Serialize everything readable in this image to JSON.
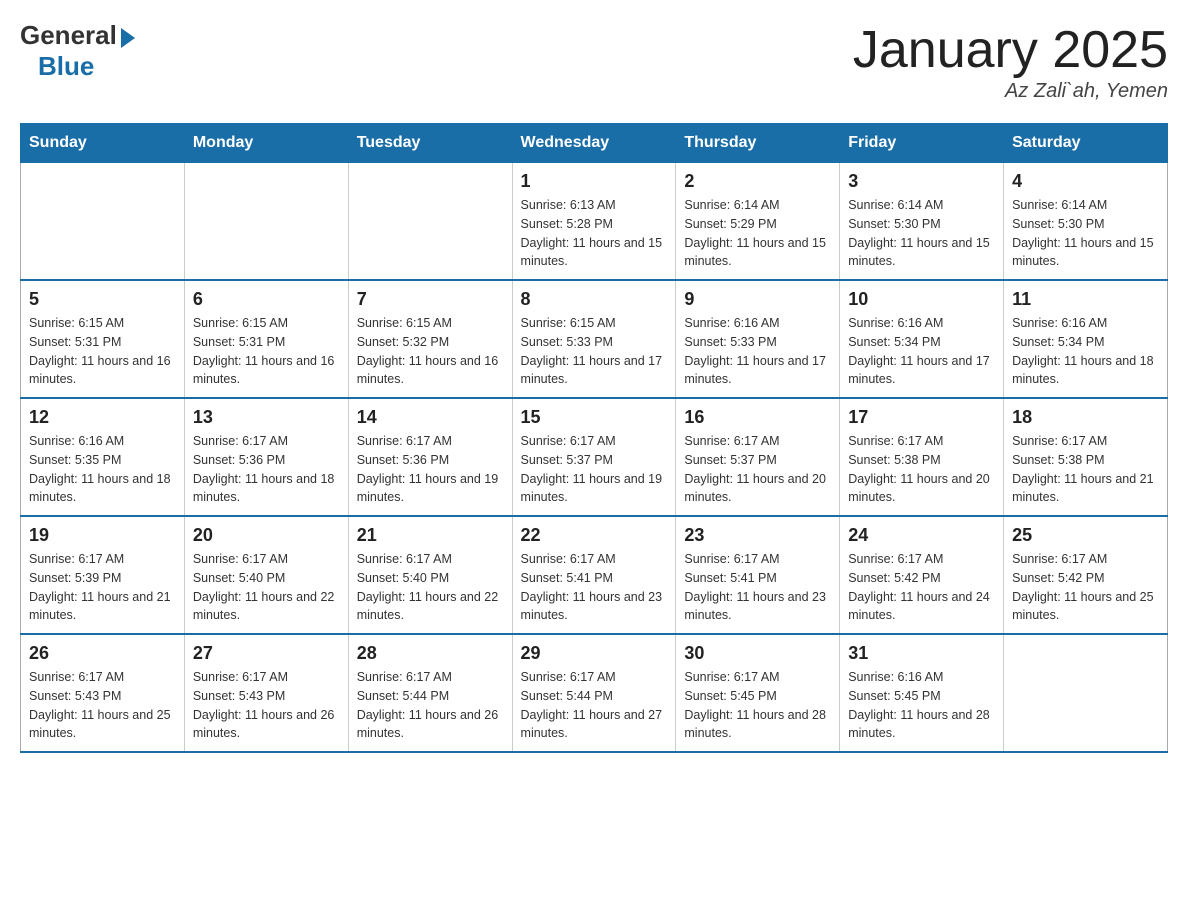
{
  "header": {
    "logo_general": "General",
    "logo_blue": "Blue",
    "month_title": "January 2025",
    "location": "Az Zali`ah, Yemen"
  },
  "calendar": {
    "days_of_week": [
      "Sunday",
      "Monday",
      "Tuesday",
      "Wednesday",
      "Thursday",
      "Friday",
      "Saturday"
    ],
    "weeks": [
      [
        {
          "day": "",
          "info": ""
        },
        {
          "day": "",
          "info": ""
        },
        {
          "day": "",
          "info": ""
        },
        {
          "day": "1",
          "info": "Sunrise: 6:13 AM\nSunset: 5:28 PM\nDaylight: 11 hours and 15 minutes."
        },
        {
          "day": "2",
          "info": "Sunrise: 6:14 AM\nSunset: 5:29 PM\nDaylight: 11 hours and 15 minutes."
        },
        {
          "day": "3",
          "info": "Sunrise: 6:14 AM\nSunset: 5:30 PM\nDaylight: 11 hours and 15 minutes."
        },
        {
          "day": "4",
          "info": "Sunrise: 6:14 AM\nSunset: 5:30 PM\nDaylight: 11 hours and 15 minutes."
        }
      ],
      [
        {
          "day": "5",
          "info": "Sunrise: 6:15 AM\nSunset: 5:31 PM\nDaylight: 11 hours and 16 minutes."
        },
        {
          "day": "6",
          "info": "Sunrise: 6:15 AM\nSunset: 5:31 PM\nDaylight: 11 hours and 16 minutes."
        },
        {
          "day": "7",
          "info": "Sunrise: 6:15 AM\nSunset: 5:32 PM\nDaylight: 11 hours and 16 minutes."
        },
        {
          "day": "8",
          "info": "Sunrise: 6:15 AM\nSunset: 5:33 PM\nDaylight: 11 hours and 17 minutes."
        },
        {
          "day": "9",
          "info": "Sunrise: 6:16 AM\nSunset: 5:33 PM\nDaylight: 11 hours and 17 minutes."
        },
        {
          "day": "10",
          "info": "Sunrise: 6:16 AM\nSunset: 5:34 PM\nDaylight: 11 hours and 17 minutes."
        },
        {
          "day": "11",
          "info": "Sunrise: 6:16 AM\nSunset: 5:34 PM\nDaylight: 11 hours and 18 minutes."
        }
      ],
      [
        {
          "day": "12",
          "info": "Sunrise: 6:16 AM\nSunset: 5:35 PM\nDaylight: 11 hours and 18 minutes."
        },
        {
          "day": "13",
          "info": "Sunrise: 6:17 AM\nSunset: 5:36 PM\nDaylight: 11 hours and 18 minutes."
        },
        {
          "day": "14",
          "info": "Sunrise: 6:17 AM\nSunset: 5:36 PM\nDaylight: 11 hours and 19 minutes."
        },
        {
          "day": "15",
          "info": "Sunrise: 6:17 AM\nSunset: 5:37 PM\nDaylight: 11 hours and 19 minutes."
        },
        {
          "day": "16",
          "info": "Sunrise: 6:17 AM\nSunset: 5:37 PM\nDaylight: 11 hours and 20 minutes."
        },
        {
          "day": "17",
          "info": "Sunrise: 6:17 AM\nSunset: 5:38 PM\nDaylight: 11 hours and 20 minutes."
        },
        {
          "day": "18",
          "info": "Sunrise: 6:17 AM\nSunset: 5:38 PM\nDaylight: 11 hours and 21 minutes."
        }
      ],
      [
        {
          "day": "19",
          "info": "Sunrise: 6:17 AM\nSunset: 5:39 PM\nDaylight: 11 hours and 21 minutes."
        },
        {
          "day": "20",
          "info": "Sunrise: 6:17 AM\nSunset: 5:40 PM\nDaylight: 11 hours and 22 minutes."
        },
        {
          "day": "21",
          "info": "Sunrise: 6:17 AM\nSunset: 5:40 PM\nDaylight: 11 hours and 22 minutes."
        },
        {
          "day": "22",
          "info": "Sunrise: 6:17 AM\nSunset: 5:41 PM\nDaylight: 11 hours and 23 minutes."
        },
        {
          "day": "23",
          "info": "Sunrise: 6:17 AM\nSunset: 5:41 PM\nDaylight: 11 hours and 23 minutes."
        },
        {
          "day": "24",
          "info": "Sunrise: 6:17 AM\nSunset: 5:42 PM\nDaylight: 11 hours and 24 minutes."
        },
        {
          "day": "25",
          "info": "Sunrise: 6:17 AM\nSunset: 5:42 PM\nDaylight: 11 hours and 25 minutes."
        }
      ],
      [
        {
          "day": "26",
          "info": "Sunrise: 6:17 AM\nSunset: 5:43 PM\nDaylight: 11 hours and 25 minutes."
        },
        {
          "day": "27",
          "info": "Sunrise: 6:17 AM\nSunset: 5:43 PM\nDaylight: 11 hours and 26 minutes."
        },
        {
          "day": "28",
          "info": "Sunrise: 6:17 AM\nSunset: 5:44 PM\nDaylight: 11 hours and 26 minutes."
        },
        {
          "day": "29",
          "info": "Sunrise: 6:17 AM\nSunset: 5:44 PM\nDaylight: 11 hours and 27 minutes."
        },
        {
          "day": "30",
          "info": "Sunrise: 6:17 AM\nSunset: 5:45 PM\nDaylight: 11 hours and 28 minutes."
        },
        {
          "day": "31",
          "info": "Sunrise: 6:16 AM\nSunset: 5:45 PM\nDaylight: 11 hours and 28 minutes."
        },
        {
          "day": "",
          "info": ""
        }
      ]
    ]
  }
}
